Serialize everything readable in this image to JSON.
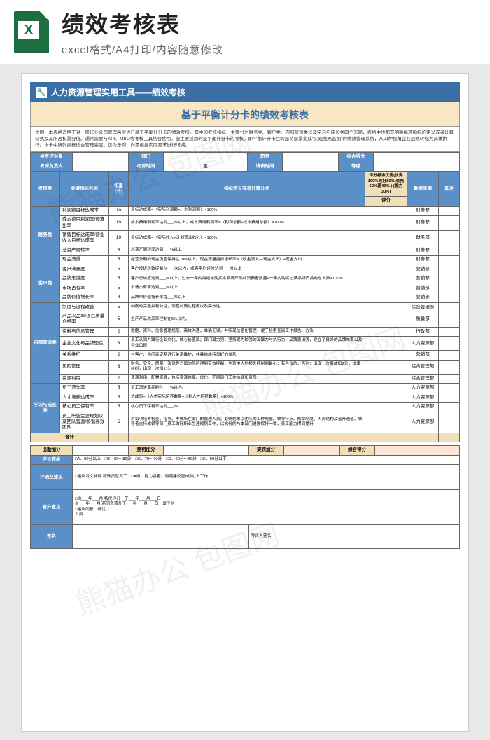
{
  "header": {
    "title": "绩效考核表",
    "subtitle": "excel格式/A4打印/内容随意修改"
  },
  "banner": {
    "icon": "🔧",
    "text": "人力资源管理实用工具——绩效考核"
  },
  "doc_title": "基于平衡计分卡的绩效考核表",
  "description": "说明：本表格适用于对一般行业公司管理高层进行基于平衡计分卡的绩效考核。其中的考核指标，主要分为财务类、客户类、内部营运类以及学习与成长类四个方面，表格中也都写明确每项指标的定义或者计算公式及其所占权重分值。通常需要与KPI、MBO等考核工具结合使用。但主要适用的是平衡计分卡的考核。即平衡计分卡目的是将愿景变成\"实现战略蓝图\"的绩效管理系统，从四种视角企业战略转化为具体执行。本卡中所列指标适合管理高层，仅为示例，尚需根据实际要求进行增减。",
  "info_row1": {
    "l1": "被考评对象",
    "l2": "部门",
    "l3": "职务",
    "l4": "综合得分"
  },
  "info_row2": {
    "l1": "考评负责人",
    "l2": "考评时间",
    "l2s": "至",
    "l3": "填表时间",
    "l4": "等级"
  },
  "table_headers": {
    "c1": "考核类",
    "c2": "关键指标名称",
    "c3": "权重(分)",
    "c4": "指标定义或者计算公式",
    "c5": "评分标准优秀(优秀100%良好80%)合格60%差40% ) (能力30%)",
    "c5b": "评分",
    "c6": "数据来源",
    "c7": "备注"
  },
  "categories": [
    {
      "name": "财务类",
      "rows": [
        {
          "indicator": "利润额目标达成率",
          "weight": "10",
          "formula": "目标达成率=（实际利润额÷计划利润额）×100%",
          "source": "财务部"
        },
        {
          "indicator": "成本费用利润率/预算比率",
          "weight": "10",
          "formula": "成本费用利润率达到___%以上。成本费用利润率=（利润总额÷成本费用总额）×100%",
          "source": "财务部"
        },
        {
          "indicator": "销售目标达成率/营业收入目标达成率",
          "weight": "10",
          "formula": "目标达成率=（实际收入÷计划营业收入）×100%",
          "source": "财务部"
        },
        {
          "indicator": "总资产周转率",
          "weight": "5",
          "formula": "总资产周转率达到___%以上",
          "source": "财务部"
        },
        {
          "indicator": "现金流量",
          "weight": "5",
          "formula": "经营分期的现金流应保持在10%以上。现金流量指标增长率=（收金流入—现金支出）÷现金支出",
          "source": "财务部"
        }
      ]
    },
    {
      "name": "客户类",
      "rows": [
        {
          "indicator": "客户满意度",
          "weight": "5",
          "formula": "客户投诉次数控制在___次以内，或客平均评分达到___分以上",
          "source": "营销部"
        },
        {
          "indicator": "品牌忠诚度",
          "weight": "5",
          "formula": "客户忠诚度达到___%以上，过去一年内最经常购买本品牌产品的消费者数量÷一年内购买过该品牌产品的总人数×100%",
          "source": "营销部"
        },
        {
          "indicator": "市场占有率",
          "weight": "5",
          "formula": "市场占有率达到___%以上",
          "source": "营销部"
        },
        {
          "indicator": "品牌价值增长率",
          "weight": "3",
          "formula": "品牌市价值增长率在___%以上",
          "source": "营销部"
        }
      ]
    },
    {
      "name": "内部营运类",
      "rows": [
        {
          "indicator": "制度与流程改善",
          "weight": "5",
          "formula": "制度的完善并有效性，流程的简化程度以及高效性",
          "source": "综合管理部"
        },
        {
          "indicator": "产品次品率/项目质量合格率",
          "weight": "5",
          "formula": "生产产品次品率控制在5%以内。",
          "source": "质量部"
        },
        {
          "indicator": "资料与信息管理",
          "weight": "2",
          "formula": "数据、资料、信息管理规范，高效沟通，准确无误，并实现信息化管理，便于检索查阅工作报告。方法",
          "source": "行政部"
        },
        {
          "indicator": "企业文化与品牌塑造",
          "weight": "3",
          "formula": "员工认同并践行企业文化，核心价值观；部门凝力强；坚持现为较强的凝聚力与执行力；品牌意识强，建立了良好的品牌效率以及企业口碑",
          "source": "人力资源部"
        },
        {
          "indicator": "关系维护",
          "weight": "2",
          "formula": "与客户、供应商定期进行关系维护，并具体维持良好的关系",
          "source": "营销部"
        },
        {
          "indicator": "风险管理",
          "weight": "3",
          "formula": "财务、安全、质量、法律等方面的风险得到有效控制，生意中人均损失控制到最小；有异议的，否则：出现一次事故扣2分，法律纠纷，出现一次扣1分。",
          "source": "综合管理部"
        },
        {
          "indicator": "资源利用",
          "weight": "2",
          "formula": "资源利用，配置资源，包括资源共享、优化、不同部门工作协调和资质。",
          "source": "综合管理部"
        }
      ]
    },
    {
      "name": "学习与成长类",
      "rows": [
        {
          "indicator": "员工流失率",
          "weight": "5",
          "formula": "员工流失率控制在___%以内。",
          "source": "人力资源部"
        },
        {
          "indicator": "人才培养达成率",
          "weight": "5",
          "formula": "达成率=（人才实际培养数量÷计划人才培养数量）×100%",
          "source": "人力资源部"
        },
        {
          "indicator": "核心员工保有率",
          "weight": "5",
          "formula": "核心员工保有率达到___%",
          "source": "人力资源部"
        },
        {
          "indicator": "员工职业生涯规划以及团队营造/和谐高效团队",
          "weight": "5",
          "formula": "对每项培养检查，指导、考核所在部门的管理人员；最终结果以团队的工作质量、领导特点、规章制度、人员结构及晋升通道。领导者支持或领导部门员工做好职业生涯规划工作，以充份的与本部门进展保持一致，员工能力得到提升",
          "source": "人力资源部"
        }
      ]
    }
  ],
  "total_label": "合计",
  "bottom": {
    "row_attend": {
      "l1": "出勤加分",
      "l2": "奖罚加分",
      "l3": "奖罚加分",
      "l4": "综合得分"
    },
    "row_grade_label": "评价等级",
    "row_grade_text": "□A．90分以上　□B．80～89分　□C．70～79分　□D．60分～69分　□E．59分以下",
    "row_suggest_label": "评语及建议",
    "row_suggest_text": "□建议发文补评 特殊贡献员工　□A级　能力强者，问题建议至B级以上工作",
    "row_promote_label": "晋升意见",
    "row_promote_text": "□自___年___月 特优评升　于___年___月___日\n自___年___月 若同意晋升于___年___月___日　发予信\n□建议同意　特优\n工资",
    "row_sign_label": "签名",
    "row_sign_text": "考评人签名:"
  }
}
